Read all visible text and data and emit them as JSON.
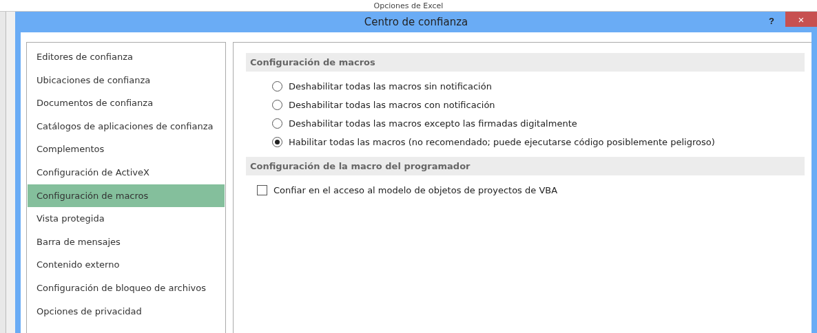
{
  "background_window": {
    "title": "Opciones de Excel"
  },
  "window": {
    "title": "Centro de confianza",
    "help": "?",
    "close": "×"
  },
  "sidebar": {
    "items": [
      {
        "label": "Editores de confianza",
        "selected": false
      },
      {
        "label": "Ubicaciones de confianza",
        "selected": false
      },
      {
        "label": "Documentos de confianza",
        "selected": false
      },
      {
        "label": "Catálogos de aplicaciones de confianza",
        "selected": false
      },
      {
        "label": "Complementos",
        "selected": false
      },
      {
        "label": "Configuración de ActiveX",
        "selected": false
      },
      {
        "label": "Configuración de macros",
        "selected": true
      },
      {
        "label": "Vista protegida",
        "selected": false
      },
      {
        "label": "Barra de mensajes",
        "selected": false
      },
      {
        "label": "Contenido externo",
        "selected": false
      },
      {
        "label": "Configuración de bloqueo de archivos",
        "selected": false
      },
      {
        "label": "Opciones de privacidad",
        "selected": false
      }
    ]
  },
  "sections": [
    {
      "title": "Configuración de macros",
      "options": [
        {
          "kind": "radio",
          "label": "Deshabilitar todas las macros sin notificación",
          "selected": false
        },
        {
          "kind": "radio",
          "label": "Deshabilitar todas las macros con notificación",
          "selected": false
        },
        {
          "kind": "radio",
          "label": "Deshabilitar todas las macros excepto las firmadas digitalmente",
          "selected": false
        },
        {
          "kind": "radio",
          "label": "Habilitar todas las macros (no recomendado; puede ejecutarse código posiblemente peligroso)",
          "selected": true
        }
      ]
    },
    {
      "title": "Configuración de la macro del programador",
      "options": [
        {
          "kind": "checkbox",
          "label": "Confiar en el acceso al modelo de objetos de proyectos de VBA",
          "checked": false
        }
      ]
    }
  ]
}
